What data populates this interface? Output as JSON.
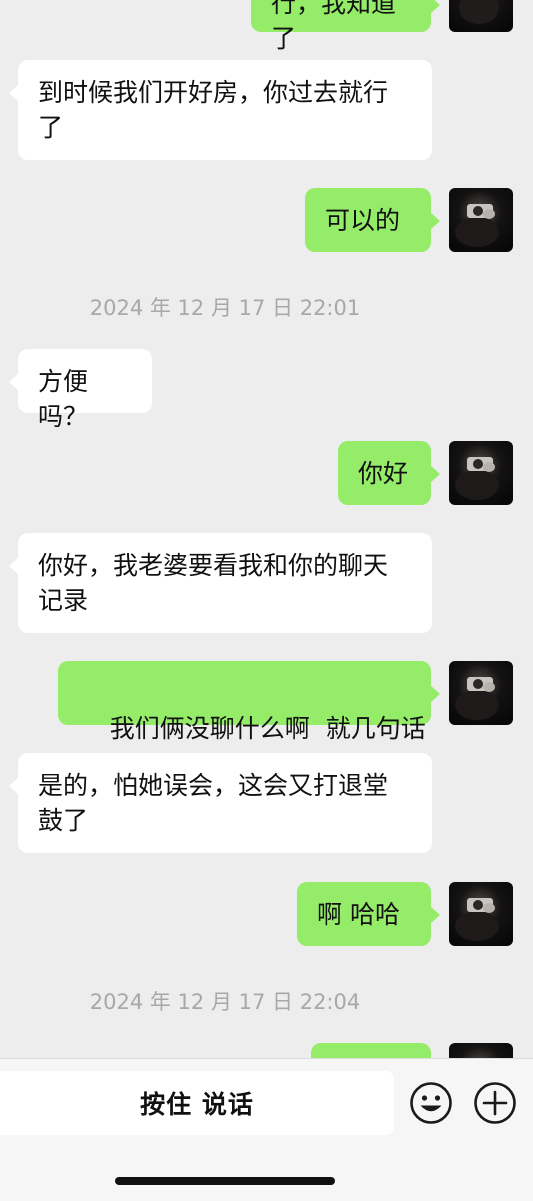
{
  "chat": {
    "messages": [
      {
        "text": "行，我知道了"
      },
      {
        "text": "到时候我们开好房，你过去就行了"
      },
      {
        "text": "可以的"
      },
      {
        "text": "方便吗？"
      },
      {
        "text": "你好"
      },
      {
        "text": "你好，我老婆要看我和你的聊天记录"
      },
      {
        "text": "我们俩没聊什么啊  就几句话"
      },
      {
        "text": "是的，怕她误会，这会又打退堂鼓了"
      },
      {
        "text": "啊 哈哈"
      },
      {
        "text": ""
      }
    ],
    "timestamps": [
      "2024 年 12 月 17 日  22:01",
      "2024 年 12 月 17 日  22:04"
    ]
  },
  "input_bar": {
    "voice_button_label": "按住 说话",
    "emoji_icon": "smile-emoji-icon",
    "more_icon": "plus-circle-icon"
  },
  "colors": {
    "background": "#ededed",
    "outgoing_bubble": "#95ec69",
    "incoming_bubble": "#ffffff",
    "timestamp_text": "#a8a8a8"
  }
}
